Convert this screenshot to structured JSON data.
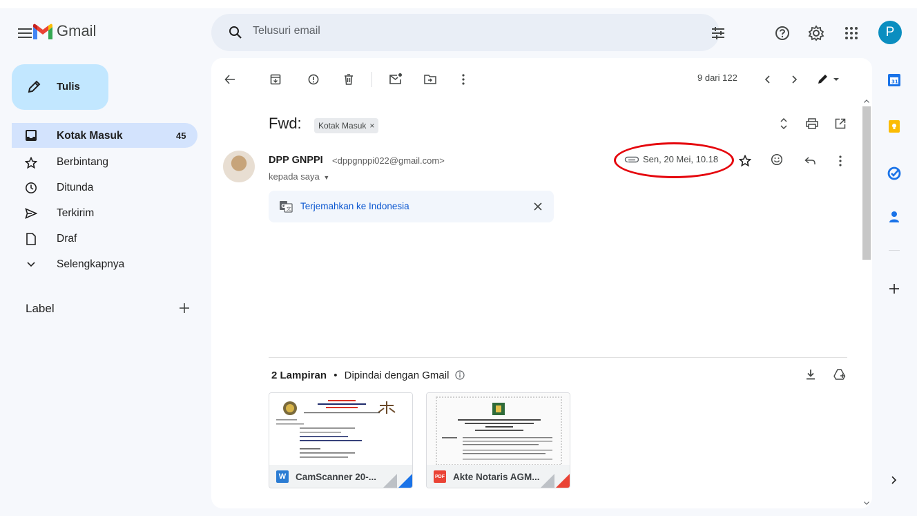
{
  "header": {
    "app_name": "Gmail",
    "search_placeholder": "Telusuri email",
    "avatar_initial": "P"
  },
  "sidebar": {
    "compose_label": "Tulis",
    "items": [
      {
        "label": "Kotak Masuk",
        "count": "45"
      },
      {
        "label": "Berbintang"
      },
      {
        "label": "Ditunda"
      },
      {
        "label": "Terkirim"
      },
      {
        "label": "Draf"
      },
      {
        "label": "Selengkapnya"
      }
    ],
    "labels_heading": "Label"
  },
  "toolbar": {
    "position": "9 dari 122"
  },
  "email": {
    "subject": "Fwd:",
    "chip": "Kotak Masuk",
    "chip_close": "×",
    "sender_name": "DPP GNPPI",
    "sender_email": "<dppgnppi022@gmail.com>",
    "recipient": "kepada saya",
    "date": "Sen, 20 Mei, 10.18",
    "translate_label": "Terjemahkan ke Indonesia"
  },
  "attachments": {
    "count_label": "2 Lampiran",
    "scan_label": "Dipindai dengan Gmail",
    "files": [
      {
        "name": "CamScanner 20-...",
        "badge": "W",
        "badge_color": "#2b7cd3",
        "corner_color": "#1a73e8"
      },
      {
        "name": "Akte Notaris AGM...",
        "badge": "PDF",
        "badge_color": "#ea4335",
        "corner_color": "#ea4335"
      }
    ]
  },
  "colors": {
    "accent": "#0b57d0",
    "compose_bg": "#c2e7ff",
    "active_nav_bg": "#d3e3fd",
    "annotation_red": "#e5050c"
  }
}
